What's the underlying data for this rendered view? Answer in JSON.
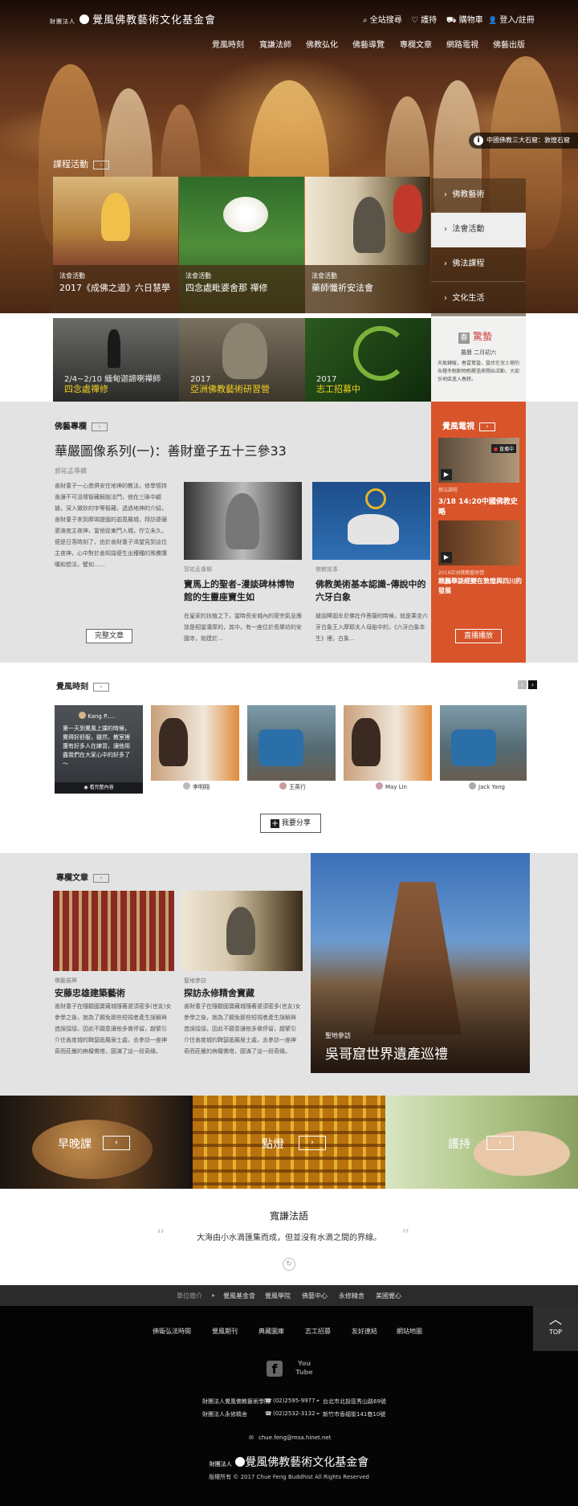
{
  "site": {
    "logo_prefix": "財團法人",
    "logo_text": "覺風佛教藝術文化基金會"
  },
  "util_nav": [
    {
      "icon": "search-icon",
      "glyph": "⌕",
      "label": "全站搜尋"
    },
    {
      "icon": "heart-icon",
      "glyph": "♡",
      "label": "護持"
    },
    {
      "icon": "cart-icon",
      "glyph": "⛟",
      "label": "購物車"
    },
    {
      "icon": "user-icon",
      "glyph": "👤",
      "label": "登入/註冊"
    }
  ],
  "main_nav": [
    "覺風時刻",
    "寬謙法師",
    "佛教弘化",
    "佛藝導覽",
    "專欄文章",
    "網路電視",
    "佛藝出版"
  ],
  "hero": {
    "caption": "中國佛教三大石窟：敦煌石窟"
  },
  "courses": {
    "title": "課程活動",
    "items": [
      {
        "category": "法會活動",
        "title": "2017《成佛之道》六日慧學"
      },
      {
        "category": "法會活動",
        "title": "四念處毗婆舍那 禪修"
      },
      {
        "category": "法會活動",
        "title": "藥師懺祈安法會"
      }
    ]
  },
  "side_menu": [
    "佛教藝術",
    "法會活動",
    "佛法課程",
    "文化生活"
  ],
  "banners": [
    {
      "date": "2/4~2/10 緬甸迦諦喇禪師",
      "title": "四念處禪修"
    },
    {
      "date": "2017",
      "title": "亞洲佛教藝術研習營"
    },
    {
      "date": "2017",
      "title": "志工招募中"
    }
  ],
  "calendar": {
    "name": "驚蟄",
    "date": "農曆 二月初六",
    "text": "天氣轉暖，春雷驚蟄，蟄伏在泥土裡的各種冬眠動物甦醒過來開始活動，大部份地區進入春耕。"
  },
  "article": {
    "section": "佛藝專欄",
    "title": "華嚴圖像系列(一)：善財童子五十三參33",
    "author": "郭祐孟專欄",
    "body": "善財童子一心悉俱安住地神的教法，修學憶持善讓不可沮壞智藏解脫法門，他在三昧中顧據，深入微妙的字等智藏，透過地神的介紹，善財童子來到摩竭提國的迦毘羅城，拜訪婆珊婆演底主夜神，當他從東門入城，佇立未久，便是日落時刻了，由於善財童子渴望見到這位主夜神，心中對於善知識便生出種種的殊勝讚嘆和想法，譬如……",
    "more": "完整文章",
    "cards": [
      {
        "author": "郭祐孟專欄",
        "title": "寶馬上的聖者–漫談碑林博物館的生靈座寶生如",
        "excerpt": "在皇家的扶植之下，當時長安城內的密宗氣息應該是相當濃厚的，其中，有一座位於長樂坊的安國寺，始建於…"
      },
      {
        "author": "佛教故事",
        "title": "佛教美術基本認識–傳說中的六牙白象",
        "excerpt": "據說釋迦牟尼佛在作菩薩的時候，就是乘坐六牙白象王入摩耶夫人母胎中的，《六牙白象本生》裡，白象…"
      }
    ]
  },
  "tv": {
    "title": "覺風電視",
    "live": "直播中",
    "items": [
      {
        "category": "佛法課程",
        "title": "3/18 14:20中國佛教史略"
      },
      {
        "category": "2016亞洲佛教藝術營",
        "title": "賴鵬舉談經變在敦煌與四川的發展"
      }
    ],
    "button": "直播播放"
  },
  "moments": {
    "title": "覺風時刻",
    "first_user": "Kang P.....",
    "first_text": "第一天到覺風上課的時候，覺得好舒服，雖然，教室裡還有好多人在練習，讓他用盡我們在大家心中的好多了～",
    "first_view": "看完整內容",
    "items": [
      {
        "user": "李明翔"
      },
      {
        "user": "王英行"
      },
      {
        "user": "May Lin"
      },
      {
        "user": "Jack Yang"
      }
    ],
    "share": "我要分享"
  },
  "columns": {
    "title": "專欄文章",
    "cards": [
      {
        "category": "佛藝振興",
        "title": "安藤忠雄建築藝術",
        "excerpt": "善財童子在隨觀國寶藏城隨著婆須密多(世友)女參學之後，她為了顯免那些短視者產生誤解與造誤謗謗，因此不願意讓他多做停留，趕緊引介往善度城的鞞瑟胝羅居士處，去參訪一座神奇而莊嚴的栴檀佛塔，圓滿了這一段奇緣。"
      },
      {
        "category": "聖地參訪",
        "title": "探訪永修精舍寶藏",
        "excerpt": "善財童子在隨觀國寶藏城隨著婆須密多(世友)女參學之後，她為了顯免那些短視者產生誤解與造誤謗謗，因此不願意讓他多做停留，趕緊引介往善度城的鞞瑟胝羅居士處，去參訪一座神奇而莊嚴的栴檀佛塔，圓滿了這一段奇緣。"
      }
    ],
    "feature": {
      "category": "聖地參訪",
      "title": "吳哥窟世界遺產巡禮"
    }
  },
  "quick_links": [
    "早晚課",
    "點燈",
    "護持"
  ],
  "quote": {
    "author": "寬謙法語",
    "text": "大海由小水滴匯集而成，但並沒有水滴之間的界線。"
  },
  "footer": {
    "nav_label": "單位簡介",
    "nav": [
      "覺風基金會",
      "覺風學院",
      "佛藝中心",
      "永修精舍",
      "美國覺心"
    ],
    "links": [
      "佛衛弘法時間",
      "覺風期刊",
      "典藏圖庫",
      "志工招募",
      "友好連結",
      "網站地圖"
    ],
    "social": [
      {
        "icon": "facebook-icon",
        "label": "f"
      },
      {
        "icon": "youtube-icon",
        "label": "You Tube"
      }
    ],
    "contacts": [
      {
        "org": "財團法人覺風佛教藝術學院",
        "phone": "(02)2595-9977",
        "addr": "台北市北投區秀山路69號"
      },
      {
        "org": "財團法人永修精舍",
        "phone": "(02)2532-3132",
        "addr": "新竹市香福街141巷10號"
      }
    ],
    "email": "chue.feng@msa.hinet.net",
    "logo_prefix": "財團法人",
    "logo_text": "覺風佛教藝術文化基金會",
    "copyright": "版權所有 © 2017 Chue Feng Buddhist All Rights Reserved",
    "top": "TOP"
  }
}
